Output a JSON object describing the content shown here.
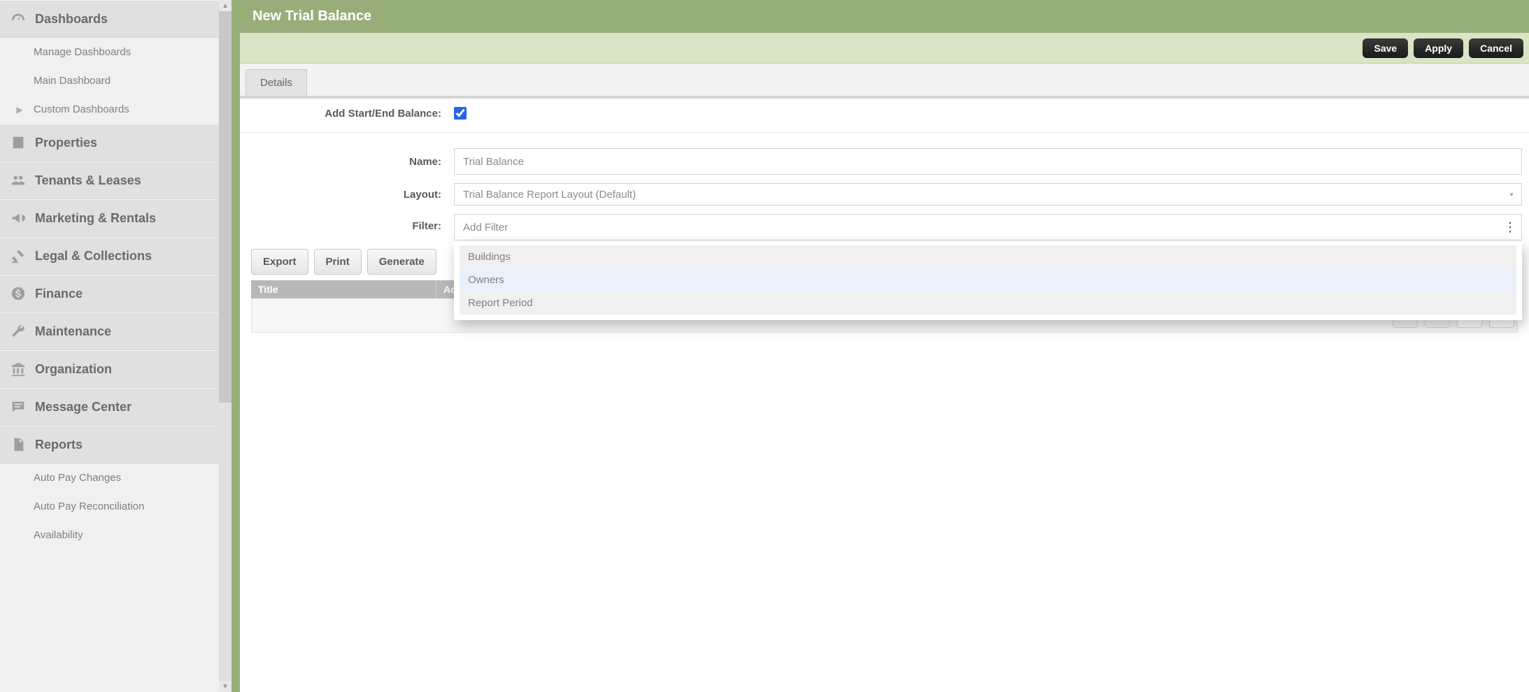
{
  "header": {
    "title": "New Trial Balance"
  },
  "toolbar": {
    "save": "Save",
    "apply": "Apply",
    "cancel": "Cancel"
  },
  "tabs": {
    "details": "Details"
  },
  "form": {
    "addBalance": {
      "label": "Add Start/End Balance:",
      "checked": true
    },
    "name": {
      "label": "Name:",
      "value": "Trial Balance"
    },
    "layout": {
      "label": "Layout:",
      "value": "Trial Balance Report Layout (Default)"
    },
    "filter": {
      "label": "Filter:",
      "placeholder": "Add Filter"
    },
    "filterOptions": [
      "Buildings",
      "Owners",
      "Report Period"
    ]
  },
  "actions": {
    "export": "Export",
    "print": "Print",
    "generate": "Generate"
  },
  "grid": {
    "cols": {
      "title": "Title",
      "account": "Acc",
      "more": "..."
    }
  },
  "sidebar": {
    "sections": [
      {
        "id": "dashboards",
        "label": "Dashboards",
        "icon": "gauge",
        "sub": [
          {
            "label": "Manage Dashboards"
          },
          {
            "label": "Main Dashboard"
          },
          {
            "label": "Custom Dashboards",
            "arrow": true
          }
        ]
      },
      {
        "id": "properties",
        "label": "Properties",
        "icon": "building"
      },
      {
        "id": "tenants",
        "label": "Tenants & Leases",
        "icon": "people"
      },
      {
        "id": "marketing",
        "label": "Marketing & Rentals",
        "icon": "bullhorn"
      },
      {
        "id": "legal",
        "label": "Legal & Collections",
        "icon": "gavel"
      },
      {
        "id": "finance",
        "label": "Finance",
        "icon": "dollar"
      },
      {
        "id": "maintenance",
        "label": "Maintenance",
        "icon": "wrench"
      },
      {
        "id": "organization",
        "label": "Organization",
        "icon": "institution"
      },
      {
        "id": "message",
        "label": "Message Center",
        "icon": "chat"
      },
      {
        "id": "reports",
        "label": "Reports",
        "icon": "document",
        "sub": [
          {
            "label": "Auto Pay Changes"
          },
          {
            "label": "Auto Pay Reconciliation"
          },
          {
            "label": "Availability"
          }
        ]
      }
    ]
  }
}
